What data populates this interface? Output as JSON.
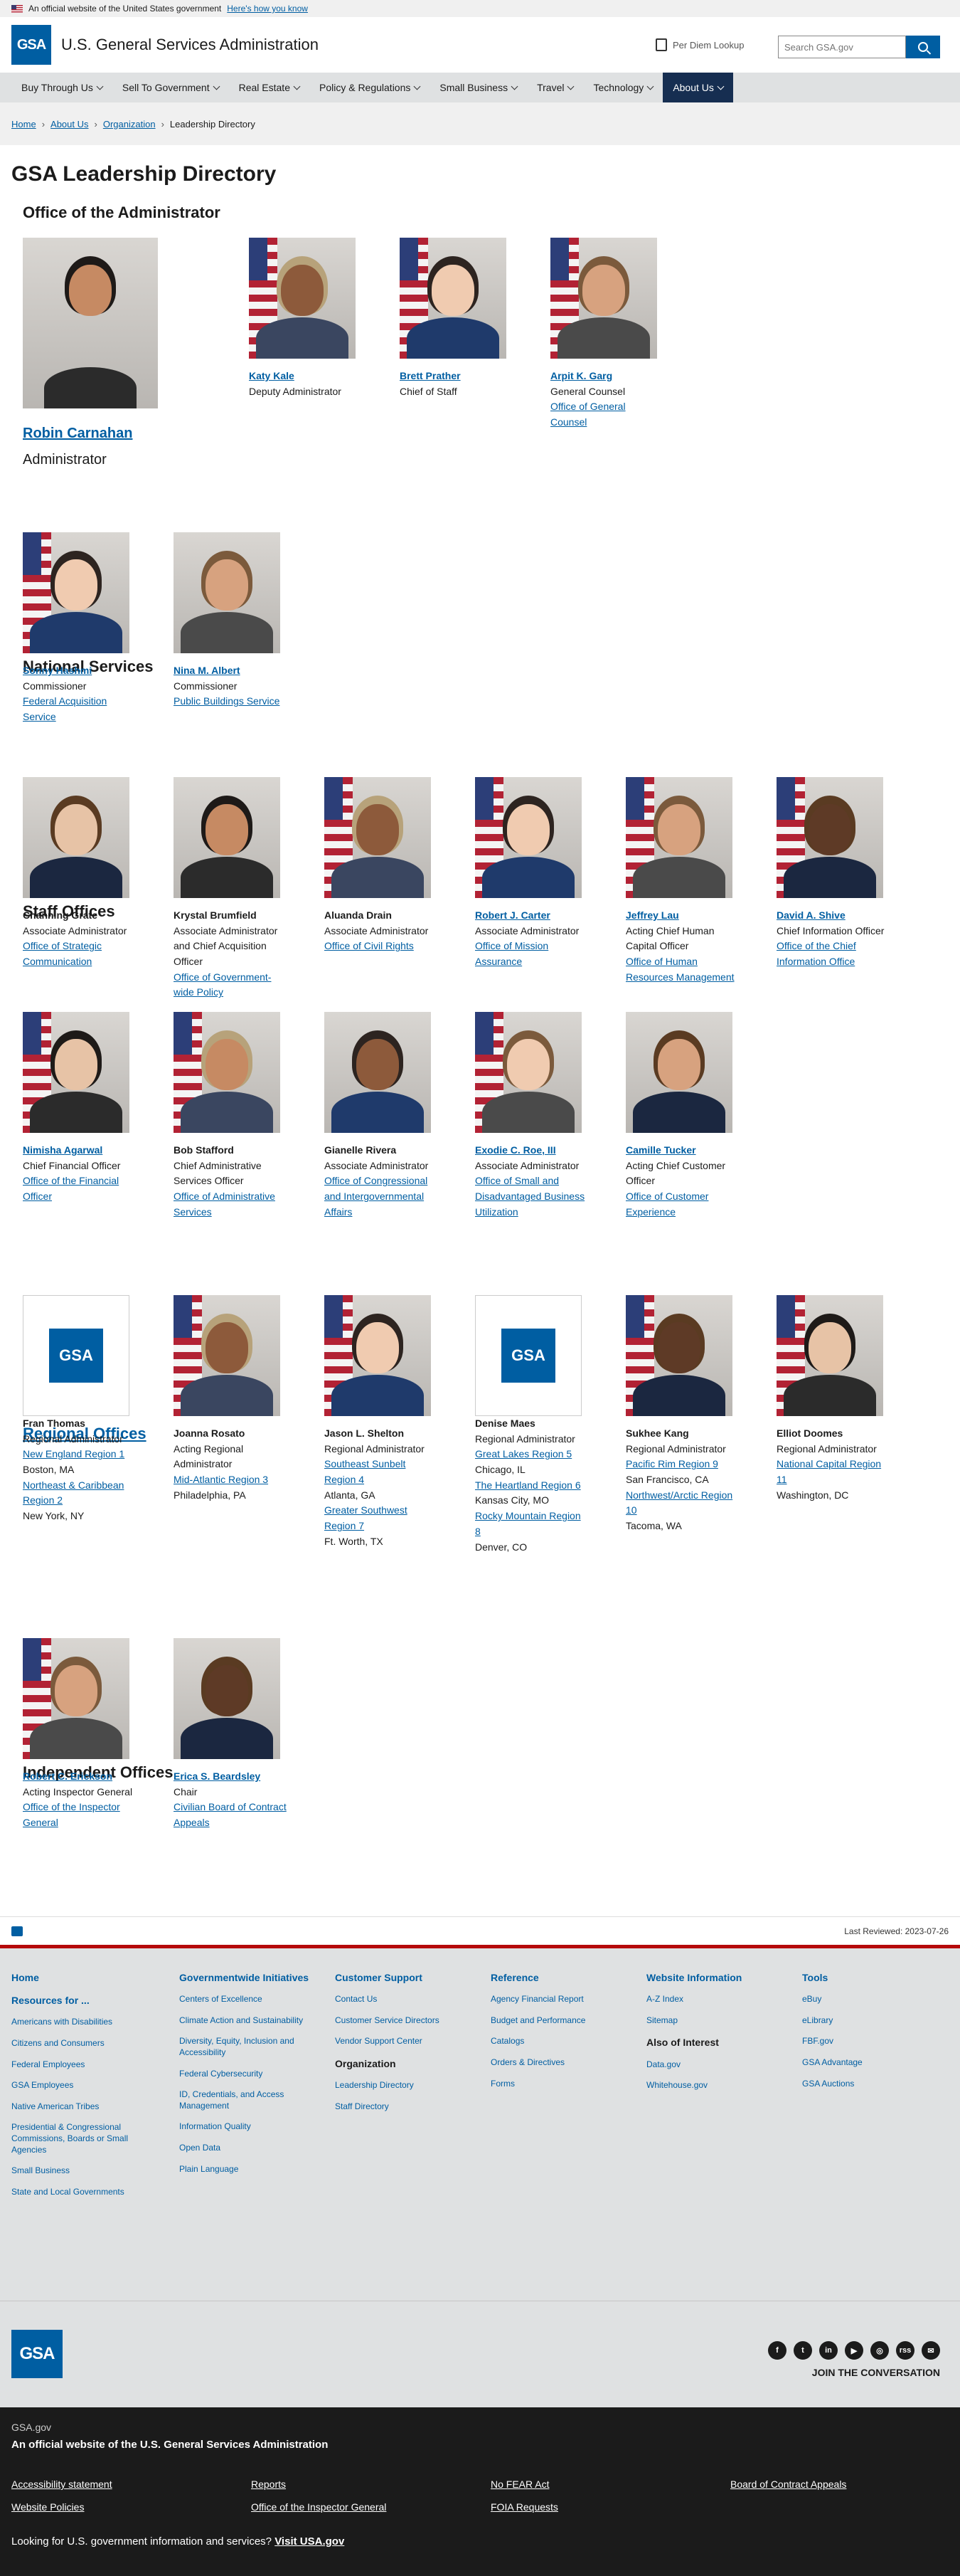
{
  "banner": {
    "text": "An official website of the United States government",
    "link": "Here's how you know"
  },
  "header": {
    "agency": "U.S. General Services Administration",
    "logo_text": "GSA",
    "per_diem": "Per Diem Lookup",
    "search_placeholder": "Search GSA.gov"
  },
  "nav": [
    "Buy Through Us",
    "Sell To Government",
    "Real Estate",
    "Policy & Regulations",
    "Small Business",
    "Travel",
    "Technology",
    "About Us"
  ],
  "breadcrumbs": [
    "Home",
    "About Us",
    "Organization",
    "Leadership Directory"
  ],
  "page_title": "GSA Leadership Directory",
  "sections": {
    "administrator": "Office of the Administrator",
    "national": "National Services",
    "staff": "Staff Offices",
    "regional": "Regional Offices",
    "independent": "Independent Offices"
  },
  "admin": {
    "name": "Robin Carnahan",
    "title": "Administrator"
  },
  "admin_staff": [
    {
      "name": "Katy Kale",
      "title": "Deputy Administrator"
    },
    {
      "name": "Brett Prather",
      "title": "Chief of Staff"
    },
    {
      "name": "Arpit K. Garg",
      "title": "General Counsel",
      "org": "Office of General Counsel"
    }
  ],
  "national": [
    {
      "name": "Sonny Hashmi",
      "title": "Commissioner",
      "org": "Federal Acquisition Service"
    },
    {
      "name": "Nina M. Albert",
      "title": "Commissioner",
      "org": "Public Buildings Service"
    }
  ],
  "staff": [
    {
      "name": "Channing Grate",
      "title": "Associate Administrator",
      "org": "Office of Strategic Communication"
    },
    {
      "name": "Krystal Brumfield",
      "title": "Associate Administrator and Chief Acquisition Officer",
      "org": "Office of Government-wide Policy"
    },
    {
      "name": "Aluanda Drain",
      "title": "Associate Administrator",
      "org": "Office of Civil Rights"
    },
    {
      "name": "Robert J. Carter",
      "title": "Associate Administrator",
      "org": "Office of Mission Assurance"
    },
    {
      "name": "Jeffrey Lau",
      "title": "Acting Chief Human Capital Officer",
      "org": "Office of Human Resources Management"
    },
    {
      "name": "David A. Shive",
      "title": "Chief Information Officer",
      "org": "Office of the Chief Information Office"
    },
    {
      "name": "Nimisha Agarwal",
      "title": "Chief Financial Officer",
      "org": "Office of the Financial Officer"
    },
    {
      "name": "Bob Stafford",
      "title": "Chief Administrative Services Officer",
      "org": "Office of Administrative Services"
    },
    {
      "name": "Gianelle Rivera",
      "title": "Associate Administrator",
      "org": "Office of Congressional and Intergovernmental Affairs"
    },
    {
      "name": "Exodie C. Roe, III",
      "title": "Associate Administrator",
      "org": "Office of Small and Disadvantaged Business Utilization"
    },
    {
      "name": "Camille Tucker",
      "title": "Acting Chief Customer Officer",
      "org": "Office of Customer Experience"
    }
  ],
  "regional": [
    {
      "name": "Fran Thomas",
      "title": "Regional Administrator",
      "regions": [
        {
          "r": "New England Region 1",
          "c": "Boston, MA"
        },
        {
          "r": "Northeast & Caribbean Region 2",
          "c": "New York, NY"
        }
      ]
    },
    {
      "name": "Joanna Rosato",
      "title": "Acting Regional Administrator",
      "regions": [
        {
          "r": "Mid-Atlantic Region 3",
          "c": "Philadelphia, PA"
        }
      ]
    },
    {
      "name": "Jason L. Shelton",
      "title": "Regional Administrator",
      "regions": [
        {
          "r": "Southeast Sunbelt Region 4",
          "c": "Atlanta, GA"
        },
        {
          "r": "Greater Southwest Region 7",
          "c": "Ft. Worth, TX"
        }
      ]
    },
    {
      "name": "Denise Maes",
      "title": "Regional Administrator",
      "regions": [
        {
          "r": "Great Lakes Region 5",
          "c": "Chicago, IL"
        },
        {
          "r": "The Heartland Region 6",
          "c": "Kansas City, MO"
        },
        {
          "r": "Rocky Mountain Region 8",
          "c": "Denver, CO"
        }
      ]
    },
    {
      "name": "Sukhee Kang",
      "title": "Regional Administrator",
      "regions": [
        {
          "r": "Pacific Rim Region 9",
          "c": "San Francisco, CA"
        },
        {
          "r": "Northwest/Arctic Region 10",
          "c": "Tacoma, WA"
        }
      ]
    },
    {
      "name": "Elliot Doomes",
      "title": "Regional Administrator",
      "regions": [
        {
          "r": "National Capital Region 11",
          "c": "Washington, DC"
        }
      ]
    }
  ],
  "independent": [
    {
      "name": "Robert C. Erickson",
      "title": "Acting Inspector General",
      "org": "Office of the Inspector General"
    },
    {
      "name": "Erica S. Beardsley",
      "title": "Chair",
      "org": "Civilian Board of Contract Appeals"
    }
  ],
  "review": {
    "label": "Last Reviewed: 2023-07-26"
  },
  "footer": {
    "home": "Home",
    "resources_title": "Resources for ...",
    "resources": [
      "Americans with Disabilities",
      "Citizens and Consumers",
      "Federal Employees",
      "GSA Employees",
      "Native American Tribes",
      "Presidential & Congressional Commissions, Boards or Small Agencies",
      "Small Business",
      "State and Local Governments"
    ],
    "govwide_title": "Governmentwide Initiatives",
    "govwide": [
      "Centers of Excellence",
      "Climate Action and Sustainability",
      "Diversity, Equity, Inclusion and Accessibility",
      "Federal Cybersecurity",
      "ID, Credentials, and Access Management",
      "Information Quality",
      "Open Data",
      "Plain Language"
    ],
    "support_title": "Customer Support",
    "support": [
      "Contact Us",
      "Customer Service Directors",
      "Vendor Support Center"
    ],
    "org_title": "Organization",
    "org": [
      "Leadership Directory",
      "Staff Directory"
    ],
    "reference_title": "Reference",
    "reference": [
      "Agency Financial Report",
      "Budget and Performance",
      "Catalogs",
      "Orders & Directives",
      "Forms"
    ],
    "website_title": "Website Information",
    "website": [
      "A-Z Index",
      "Sitemap"
    ],
    "interest_title": "Also of Interest",
    "interest": [
      "Data.gov",
      "Whitehouse.gov"
    ],
    "tools_title": "Tools",
    "tools": [
      "eBuy",
      "eLibrary",
      "FBF.gov",
      "GSA Advantage",
      "GSA Auctions"
    ]
  },
  "brand": {
    "logo": "GSA",
    "join": "JOIN THE CONVERSATION",
    "socials": [
      "f",
      "t",
      "in",
      "▶",
      "◎",
      "rss",
      "✉"
    ]
  },
  "identity": {
    "domain": "GSA.gov",
    "official": "An official website of the U.S. General Services Administration",
    "links": [
      "Accessibility statement",
      "Reports",
      "No FEAR Act",
      "Board of Contract Appeals",
      "Website Policies",
      "Office of the Inspector General",
      "FOIA Requests"
    ],
    "looking": "Looking for U.S. government information and services?",
    "usagov": "Visit USA.gov"
  }
}
